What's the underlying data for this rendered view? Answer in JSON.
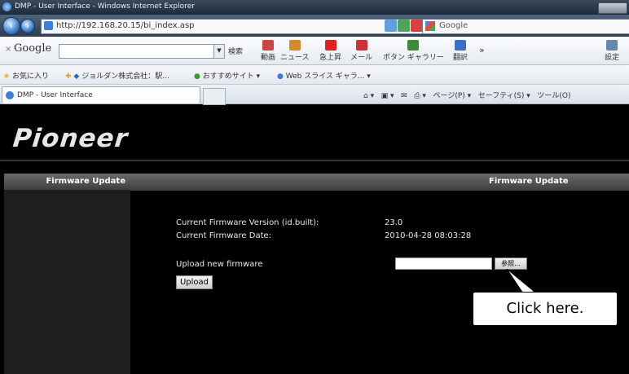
{
  "window": {
    "title": "DMP - User Interface - Windows Internet Explorer"
  },
  "address_bar": {
    "url": "http://192.168.20.15/bi_index.asp",
    "search_provider": "Google"
  },
  "google_toolbar": {
    "logo": "Google",
    "search_label": "検索",
    "items": [
      "動画",
      "ニュース",
      "急上昇",
      "メール",
      "ボタン ギャラリー",
      "翻訳",
      "設定"
    ],
    "more": "»"
  },
  "favorites_bar": {
    "favorites_label": "お気に入り",
    "items": [
      "ジョルダン株式会社：駅...",
      "おすすめサイト ▾",
      "Web スライス ギャラ... ▾"
    ]
  },
  "tab_bar": {
    "active_tab": "DMP - User Interface",
    "commands": [
      "ページ(P) ▾",
      "セーフティ(S) ▾",
      "ツール(O)"
    ]
  },
  "page": {
    "logo": "Pioneer",
    "sidebar": {
      "heading": "Firmware Update"
    },
    "main": {
      "heading": "Firmware Update",
      "current_version_label": "Current Firmware Version (id.built):",
      "current_version_value": "23.0",
      "current_date_label": "Current Firmware Date:",
      "current_date_value": "2010-04-28  08:03:28",
      "upload_label": "Upload new firmware",
      "browse_button": "参照...",
      "upload_button": "Upload",
      "file_input_value": ""
    },
    "callout": "Click here."
  },
  "colors": {
    "page_background": "#000000",
    "header_bar": "#4a4a4a",
    "sidebar": "#1e1e1e",
    "callout_bg": "#ffffff"
  }
}
